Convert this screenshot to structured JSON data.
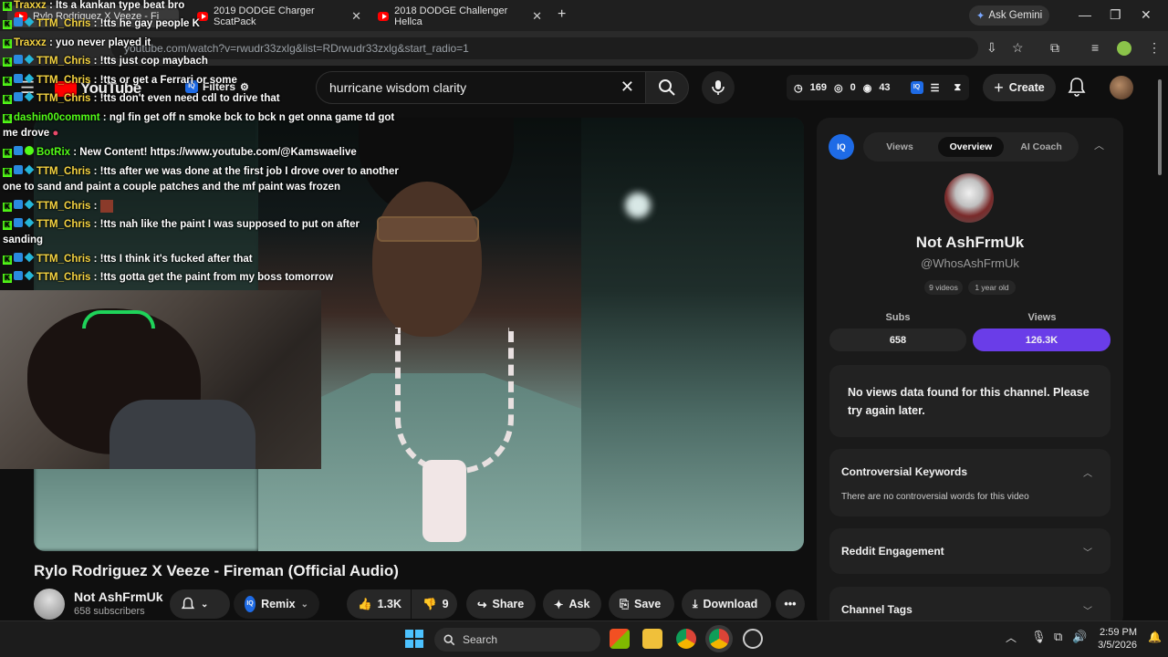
{
  "browser": {
    "tabs": [
      {
        "label": "Rylo Rodriguez X Veeze - Fi",
        "active": true
      },
      {
        "label": "2019 DODGE Charger ScatPack",
        "active": false
      },
      {
        "label": "2018 DODGE Challenger Hellca",
        "active": false
      }
    ],
    "new_tab": "+",
    "gemini_label": "Ask Gemini",
    "url": "youtube.com/watch?v=rwudr33zxlg&list=RDrwudr33zxlg&start_radio=1"
  },
  "youtube": {
    "logo": "YouTube",
    "filters_label": "Filters",
    "search_value": "hurricane wisdom clarity",
    "stats": {
      "clock": "169",
      "eye_off": "0",
      "eye": "43"
    },
    "create_label": "Create"
  },
  "video": {
    "title": "Rylo Rodriguez X Veeze - Fireman (Official Audio)",
    "channel_name": "Not AshFrmUk",
    "channel_subs": "658 subscribers",
    "remix_label": "Remix",
    "likes": "1.3K",
    "dislikes": "9",
    "share_label": "Share",
    "ask_label": "Ask",
    "save_label": "Save",
    "download_label": "Download"
  },
  "panel": {
    "logo": "IQ",
    "tabs": [
      "Views",
      "Overview",
      "AI Coach"
    ],
    "active_tab": "Overview",
    "channel_name": "Not AshFrmUk",
    "handle": "@WhosAshFrmUk",
    "chips": [
      "9 videos",
      "1 year old"
    ],
    "subs_label": "Subs",
    "subs_value": "658",
    "views_label": "Views",
    "views_value": "126.3K",
    "no_data_msg": "No views data found for this channel. Please try again later.",
    "controversial_title": "Controversial Keywords",
    "controversial_body": "There are no controversial words for this video",
    "reddit_title": "Reddit Engagement",
    "tags_title": "Channel Tags"
  },
  "chat": [
    {
      "user": "Traxxz",
      "msg": "Its a kankan type beat bro"
    },
    {
      "user": "TTM_Chris",
      "msg": "!tts he gay people K"
    },
    {
      "user": "Traxxz",
      "msg": "yuo never played it"
    },
    {
      "user": "TTM_Chris",
      "msg": "!tts just cop maybach"
    },
    {
      "user": "TTM_Chris",
      "msg": "!tts or get a Ferrari or some"
    },
    {
      "user": "TTM_Chris",
      "msg": "!tts don't even need cdl to drive that"
    },
    {
      "user": "dashin00commnt",
      "msg": "ngl fin get off n smoke bck to bck n get onna game td got",
      "msg2": "me drove"
    },
    {
      "user": "BotRix",
      "msg": "New Content! https://www.youtube.com/@Kamswaelive"
    },
    {
      "user": "TTM_Chris",
      "msg": "!tts after we was done at the first job I drove over to another",
      "msg2": "one to sand and paint a couple patches and the mf paint was frozen"
    },
    {
      "user": "TTM_Chris",
      "msg": ""
    },
    {
      "user": "TTM_Chris",
      "msg": "!tts nah like the paint I was supposed to put on after",
      "msg2": "sanding"
    },
    {
      "user": "TTM_Chris",
      "msg": "!tts I think it's fucked after that"
    },
    {
      "user": "TTM_Chris",
      "msg": "!tts gotta get the paint from my boss tomorrow"
    }
  ],
  "taskbar": {
    "search_label": "Search",
    "time": "2:59 PM",
    "date": "3/5/2026"
  },
  "colors": {
    "accent_purple": "#6a3de8",
    "yt_red": "#ff0000",
    "kick_green": "#53fc18"
  }
}
